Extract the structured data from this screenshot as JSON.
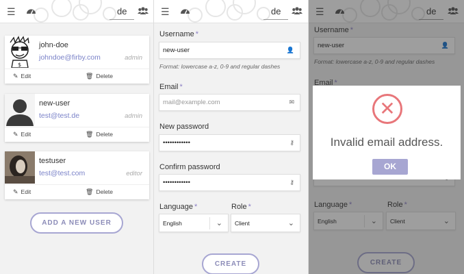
{
  "topbar": {
    "lang": "de"
  },
  "users": [
    {
      "name": "john-doe",
      "email": "johndoe@firby.com",
      "role": "admin",
      "edit": "Edit",
      "delete": "Delete"
    },
    {
      "name": "new-user",
      "email": "test@test.de",
      "role": "admin",
      "edit": "Edit",
      "delete": "Delete"
    },
    {
      "name": "testuser",
      "email": "test@test.com",
      "role": "editor",
      "edit": "Edit",
      "delete": "Delete"
    }
  ],
  "add_user_label": "ADD A NEW USER",
  "form": {
    "username_label": "Username",
    "username_value": "new-user",
    "username_hint": "Format: lowercase a-z, 0-9 and regular dashes",
    "email_label": "Email",
    "email_placeholder": "mail@example.com",
    "new_password_label": "New password",
    "new_password_value": "••••••••••••",
    "confirm_password_label": "Confirm password",
    "confirm_password_value": "••••••••••••",
    "language_label": "Language",
    "language_value": "English",
    "role_label": "Role",
    "role_value": "Client",
    "required_mark": "*",
    "create_label": "CREATE"
  },
  "dialog": {
    "message": "Invalid email address.",
    "ok_label": "OK"
  },
  "colors": {
    "accent": "#a7a6d2",
    "error": "#e8767a",
    "link": "#7a82c8"
  }
}
